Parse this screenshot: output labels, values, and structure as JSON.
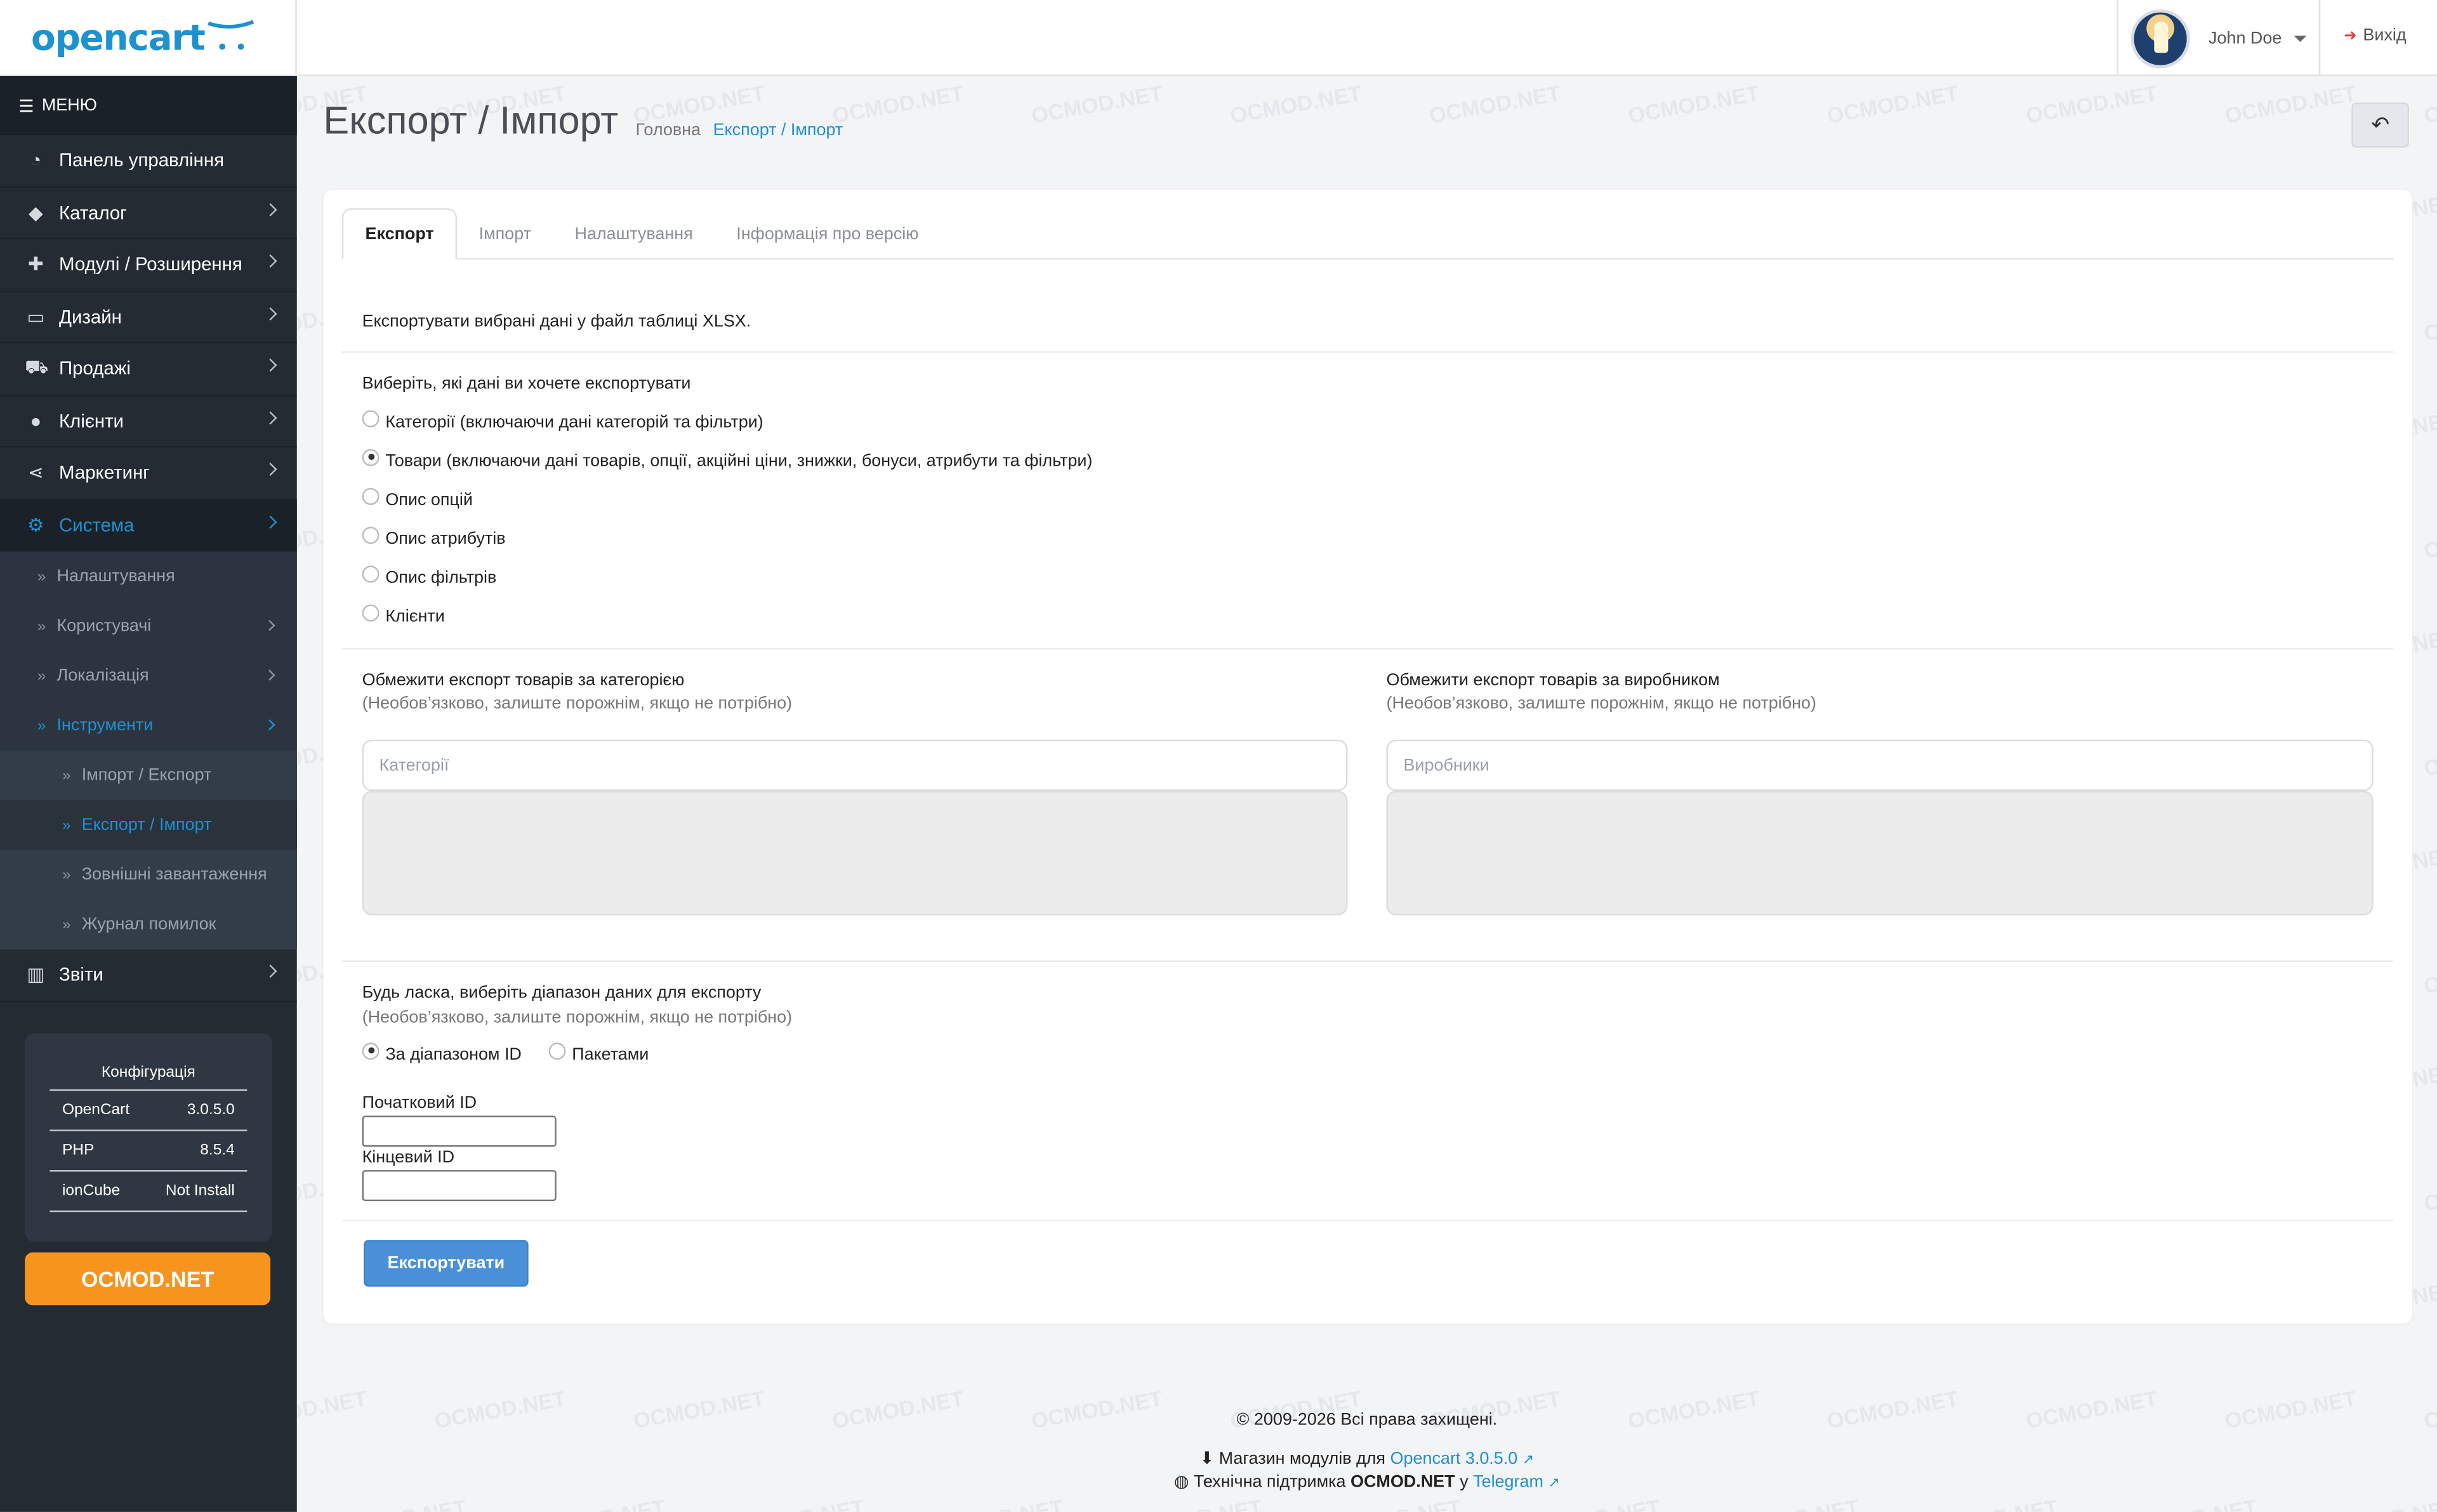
{
  "header": {
    "logo_text": "opencart",
    "user_name": "John Doe",
    "logout_label": "Вихід"
  },
  "sidebar": {
    "menu_label": "МЕНЮ",
    "items": [
      {
        "label": "Панель управління",
        "icon": "dashboard-icon"
      },
      {
        "label": "Каталог",
        "icon": "tags-icon"
      },
      {
        "label": "Модулі / Розширення",
        "icon": "puzzle-icon"
      },
      {
        "label": "Дизайн",
        "icon": "monitor-icon"
      },
      {
        "label": "Продажі",
        "icon": "cart-icon"
      },
      {
        "label": "Клієнти",
        "icon": "user-icon"
      },
      {
        "label": "Маркетинг",
        "icon": "share-icon"
      },
      {
        "label": "Система",
        "icon": "gear-icon"
      }
    ],
    "system_sub": [
      {
        "label": "Налаштування"
      },
      {
        "label": "Користувачі"
      },
      {
        "label": "Локалізація"
      },
      {
        "label": "Інструменти"
      }
    ],
    "tools_sub": [
      {
        "label": "Імпорт / Експорт"
      },
      {
        "label": "Експорт / Імпорт"
      },
      {
        "label": "Зовнішні завантаження"
      },
      {
        "label": "Журнал помилок"
      }
    ],
    "reports_label": "Звіти",
    "config": {
      "title": "Конфігурація",
      "rows": [
        {
          "name": "OpenCart",
          "value": "3.0.5.0"
        },
        {
          "name": "PHP",
          "value": "8.5.4"
        },
        {
          "name": "ionCube",
          "value": "Not Install"
        }
      ]
    },
    "promo_button": "OCMOD.NET"
  },
  "page": {
    "title": "Експорт / Імпорт",
    "breadcrumb": [
      "Головна",
      "Експорт / Імпорт"
    ]
  },
  "tabs": [
    "Експорт",
    "Імпорт",
    "Налаштування",
    "Інформація про версію"
  ],
  "export": {
    "intro": "Експортувати вибрані дані у файл таблиці XLSX.",
    "choose_label": "Виберіть, які дані ви хочете експортувати",
    "options": [
      "Категорії (включаючи дані категорій та фільтри)",
      "Товари (включаючи дані товарів, опції, акційні ціни, знижки, бонуси, атрибути та фільтри)",
      "Опис опцій",
      "Опис атрибутів",
      "Опис фільтрів",
      "Клієнти"
    ],
    "selected_option": 1,
    "category_filter": {
      "label": "Обмежити експорт товарів за категорією",
      "hint": "(Необов’язково, залиште порожнім, якщо не потрібно)",
      "placeholder": "Категорії"
    },
    "manufacturer_filter": {
      "label": "Обмежити експорт товарів за виробником",
      "hint": "(Необов’язково, залиште порожнім, якщо не потрібно)",
      "placeholder": "Виробники"
    },
    "range": {
      "label": "Будь ласка, виберіть діапазон даних для експорту",
      "hint": "(Необов’язково, залиште порожнім, якщо не потрібно)",
      "by_id": "За діапазоном ID",
      "by_batch": "Пакетами",
      "start_label": "Початковий ID",
      "end_label": "Кінцевий ID",
      "start_value": "",
      "end_value": ""
    },
    "button": "Експортувати"
  },
  "footer": {
    "copyright": "© 2009-2026 Всі права захищені.",
    "store_prefix": "Магазин модулів для",
    "store_link": "Opencart 3.0.5.0",
    "support_prefix": "Технічна підтримка",
    "support_brand": "OCMOD.NET",
    "support_mid": "у",
    "support_link": "Telegram"
  },
  "watermark": "OCMOD.NET",
  "colors": {
    "accent": "#1e91cf",
    "sidebar": "#242b33",
    "promo": "#f7941d",
    "button": "#4a90d9"
  }
}
